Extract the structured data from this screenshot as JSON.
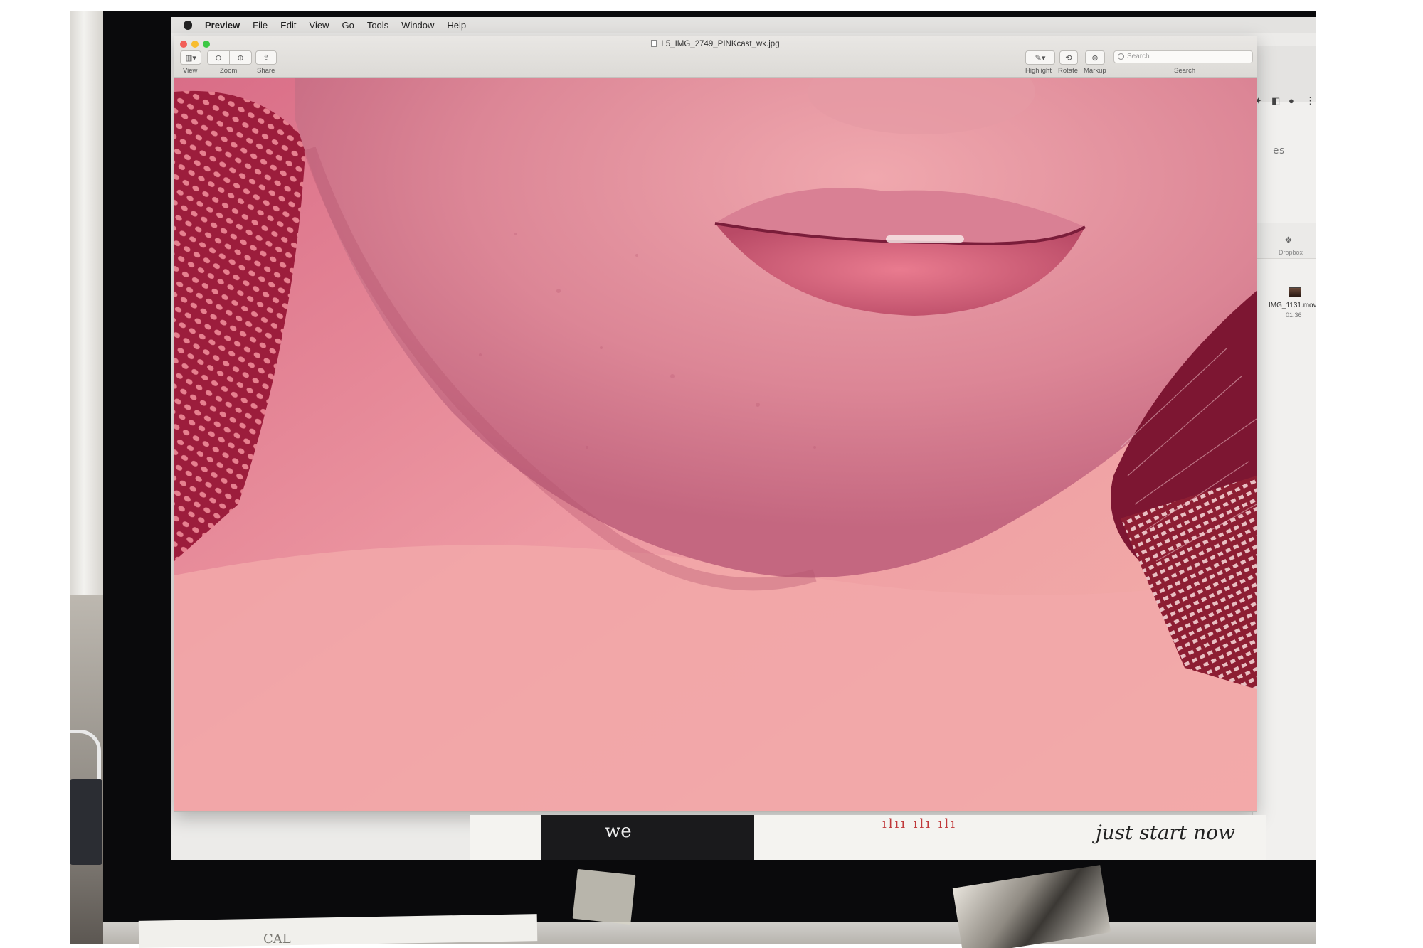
{
  "menubar": {
    "app_name": "Preview",
    "items": [
      "File",
      "Edit",
      "View",
      "Go",
      "Tools",
      "Window",
      "Help"
    ]
  },
  "preview": {
    "document_title": "L5_IMG_2749_PINKcast_wk.jpg",
    "toolbar": {
      "view_label": "View",
      "zoom_label": "Zoom",
      "share_label": "Share",
      "highlight_label": "Highlight",
      "rotate_label": "Rotate",
      "markup_label": "Markup",
      "search_label": "Search",
      "search_placeholder": "Search"
    }
  },
  "background_window": {
    "partial_text": "es",
    "dropbox_label": "Dropbox",
    "file": {
      "name": "IMG_1131.mov",
      "duration": "01:36"
    }
  },
  "desk_notes": {
    "we": "we",
    "just_start_now": "just start now",
    "bottom_scribble": "CAL"
  },
  "colors": {
    "photo_pink": "#e9a2a8",
    "photo_shadow": "#b8334f",
    "bezel": "#0a0a0c",
    "close": "#f25f58",
    "minimize": "#f8bd30",
    "zoom": "#3dc845"
  }
}
